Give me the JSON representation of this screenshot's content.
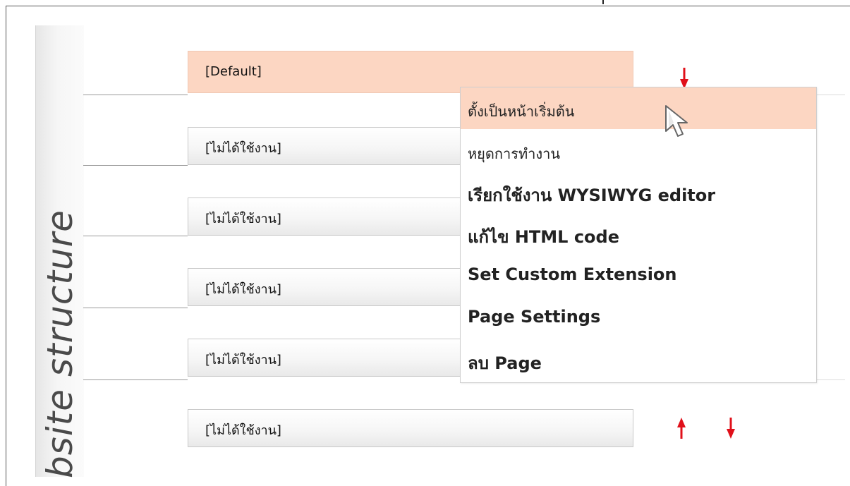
{
  "side_panel": {
    "label": "bsite structure"
  },
  "rows": [
    {
      "label": "[Default]",
      "state": "default"
    },
    {
      "label": "[ไม่ได้ใช้งาน]"
    },
    {
      "label": "[ไม่ได้ใช้งาน]"
    },
    {
      "label": "[ไม่ได้ใช้งาน]"
    },
    {
      "label": "[ไม่ได้ใช้งาน]"
    },
    {
      "label": "[ไม่ได้ใช้งาน]"
    }
  ],
  "context_menu": {
    "items": [
      {
        "label": "ตั้งเป็นหน้าเริ่มต้น",
        "highlighted": true
      },
      {
        "label": "หยุดการทำงาน"
      },
      {
        "label": "เรียกใช้งาน WYSIWYG editor"
      },
      {
        "label": "แก้ไข HTML code"
      },
      {
        "label": "Set Custom Extension"
      },
      {
        "label": "Page Settings"
      },
      {
        "label": "ลบ Page"
      }
    ]
  },
  "icons": {
    "move_up": "arrow-up-icon",
    "move_down": "arrow-down-icon",
    "pointer": "mouse-pointer-icon"
  },
  "colors": {
    "highlight": "#fcd6c2",
    "arrow": "#e0101a",
    "panel_text": "#4a4a4a"
  }
}
